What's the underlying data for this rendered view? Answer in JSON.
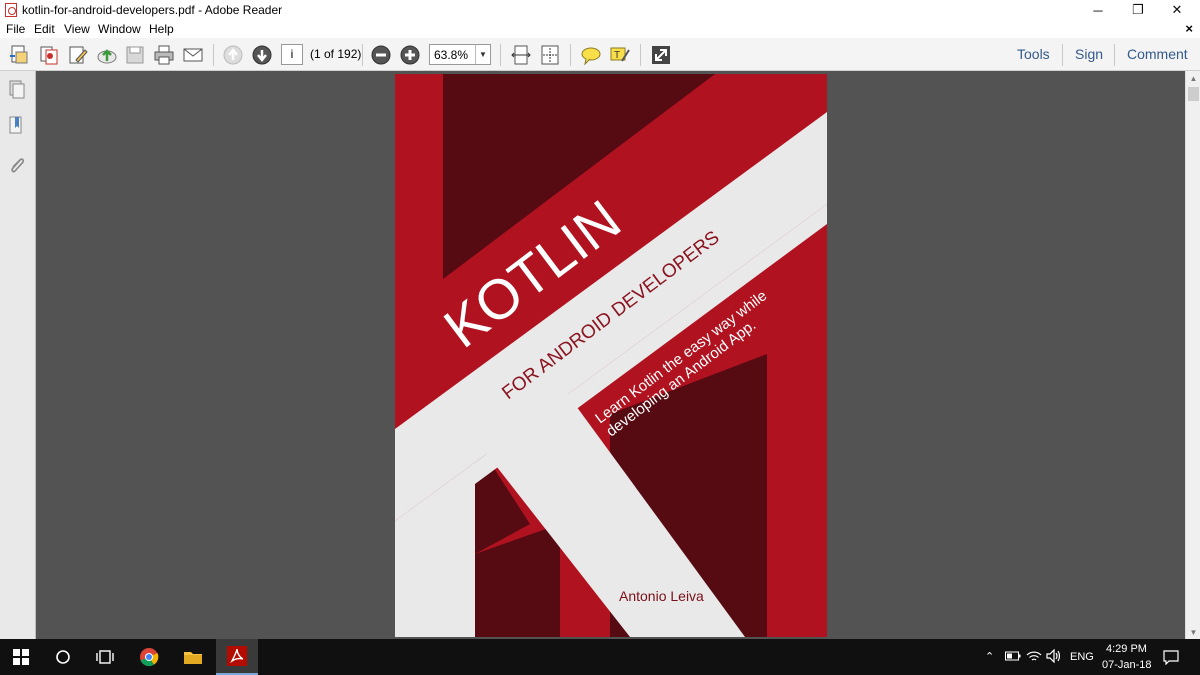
{
  "window": {
    "title": "kotlin-for-android-developers.pdf - Adobe Reader"
  },
  "window_controls": {
    "minimize": "─",
    "restore": "❐",
    "close": "✕"
  },
  "menu": {
    "items": [
      "File",
      "Edit",
      "View",
      "Window",
      "Help"
    ],
    "doc_close": "×"
  },
  "toolbar": {
    "page_value": "i",
    "page_count": "(1 of 192)",
    "zoom": "63.8%",
    "right_links": [
      "Tools",
      "Sign",
      "Comment"
    ]
  },
  "cover": {
    "title": "KOTLIN",
    "subtitle": "FOR ANDROID DEVELOPERS",
    "tagline_line1": "Learn Kotlin the easy way while",
    "tagline_line2": "developing an Android App.",
    "author": "Antonio Leiva",
    "colors": {
      "red": "#b0121f",
      "dark": "#560a12",
      "stripe": "#e9e9e9"
    }
  },
  "tray": {
    "language": "ENG",
    "time": "4:29 PM",
    "date": "07-Jan-18"
  }
}
